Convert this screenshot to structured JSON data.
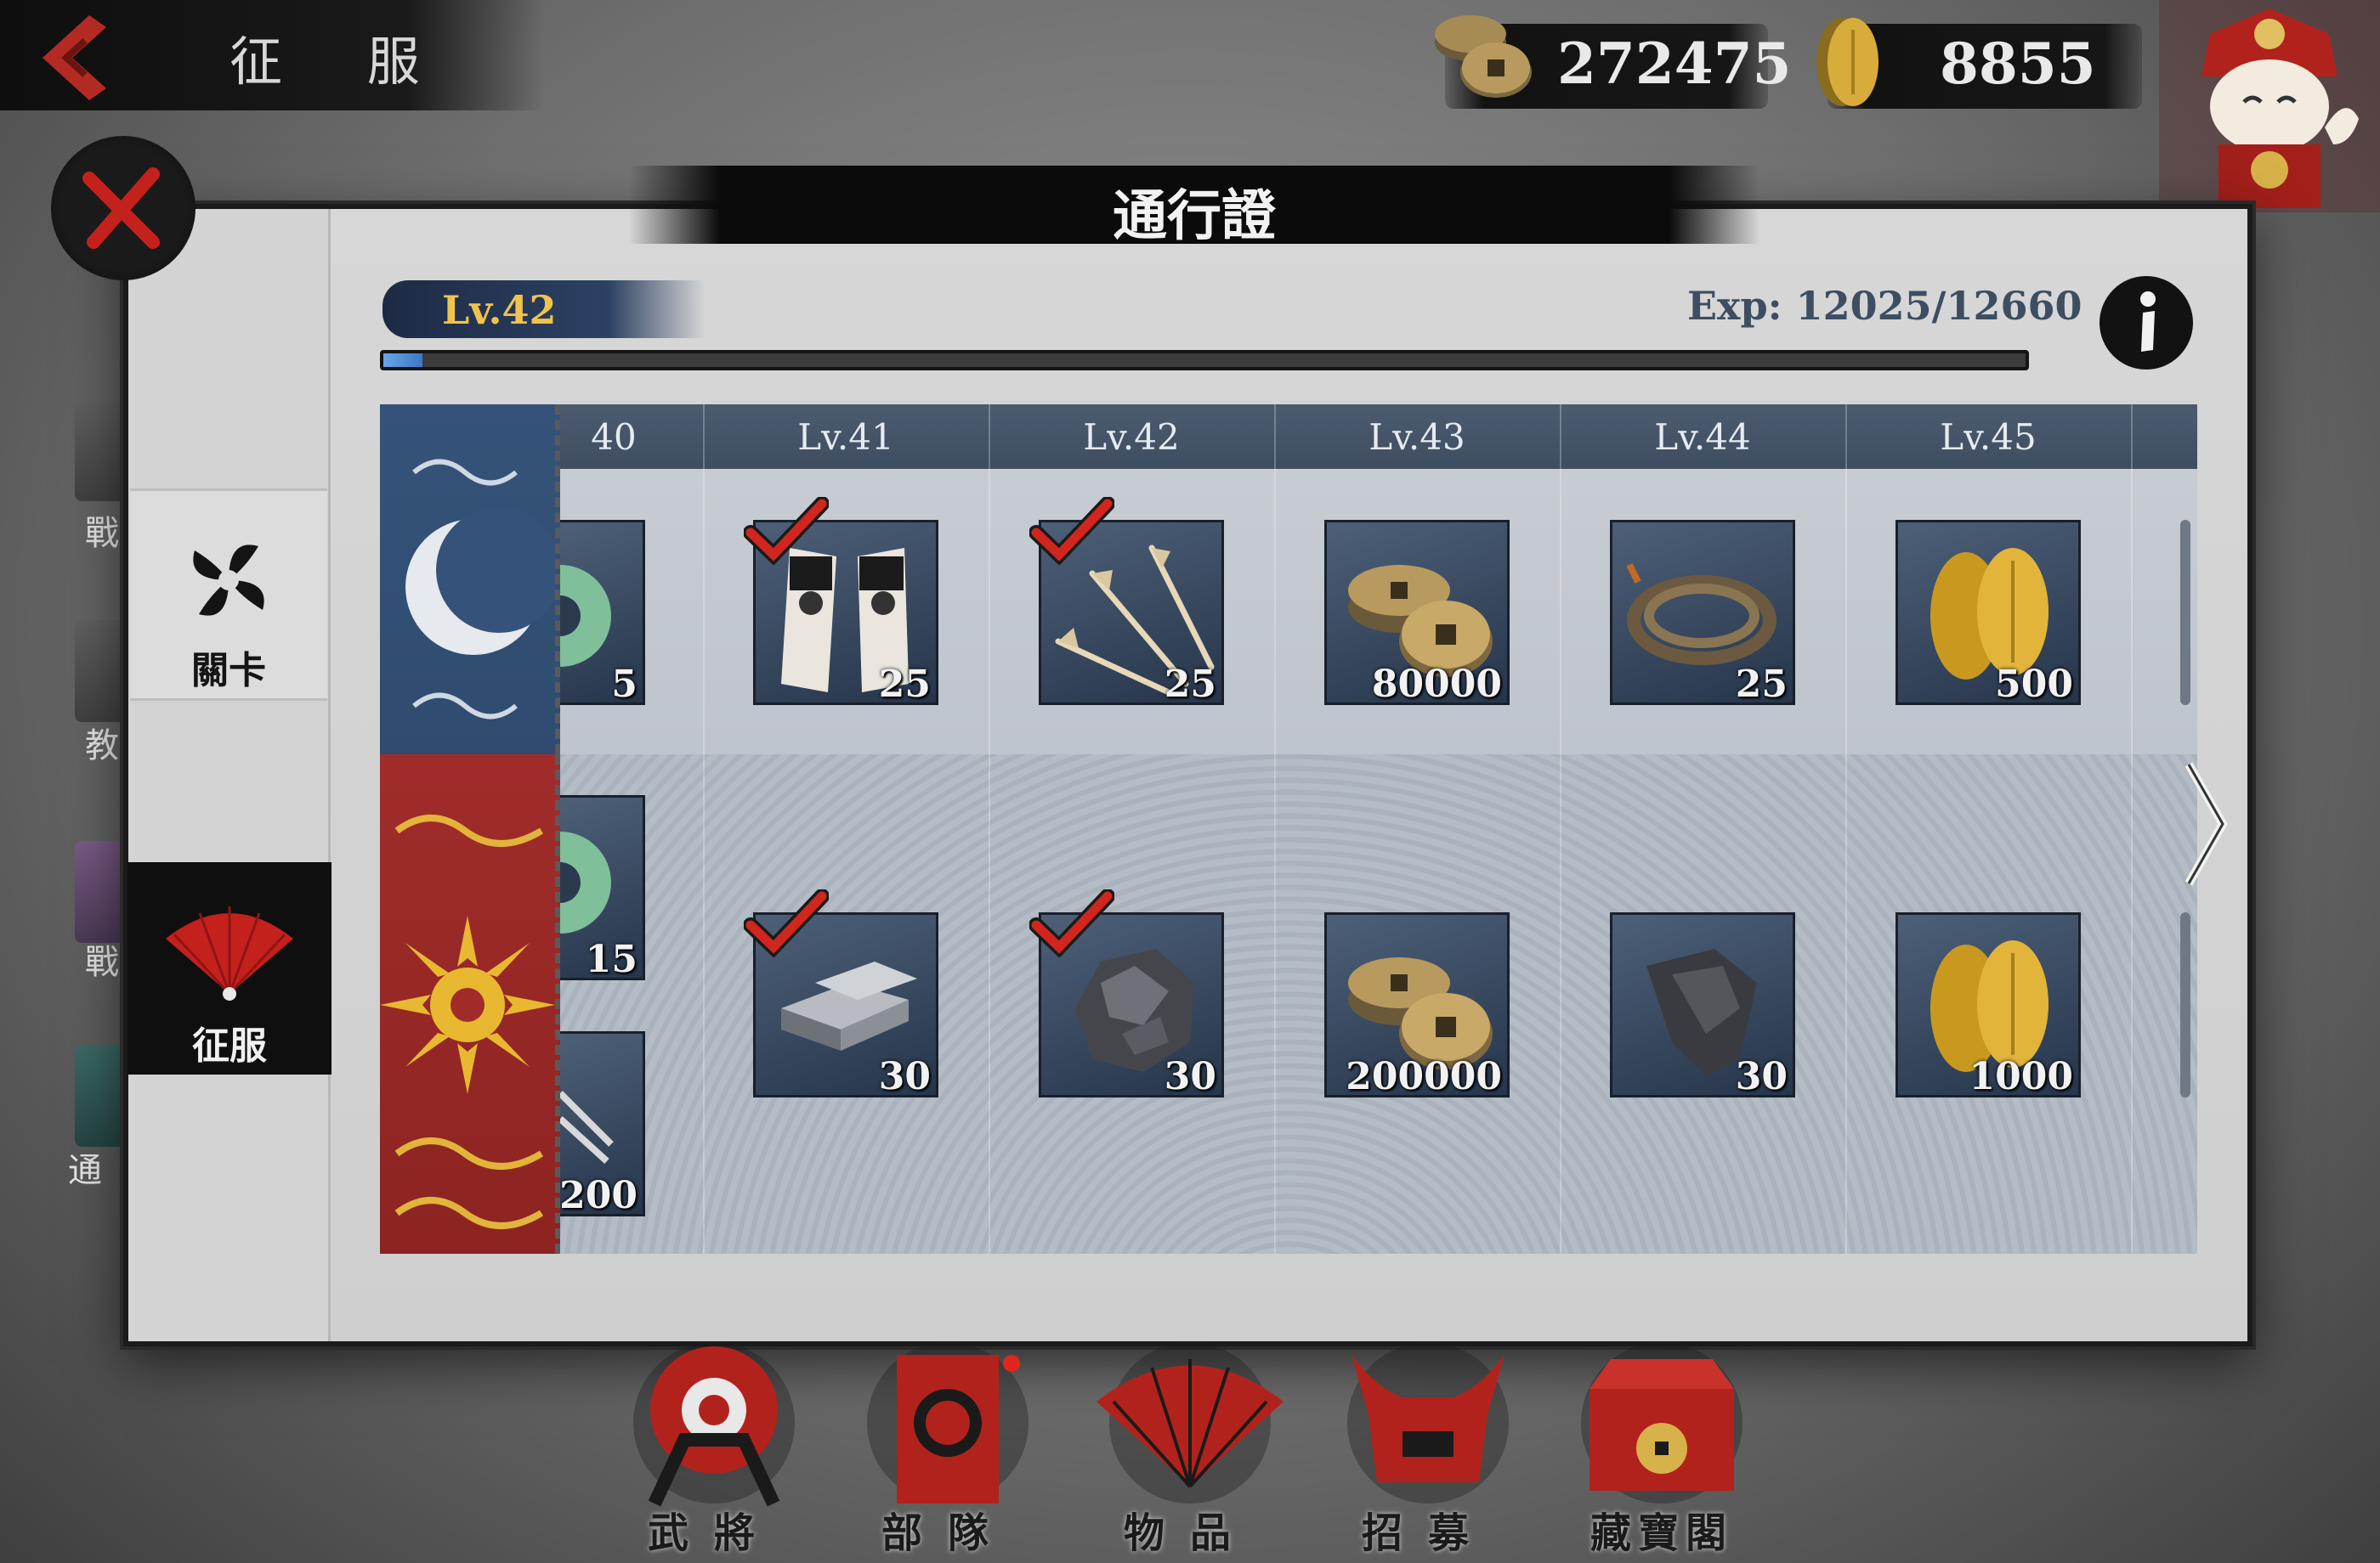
{
  "header": {
    "screen_title": "征 服",
    "coins": "272475",
    "gold": "8855"
  },
  "panel": {
    "title": "通行證",
    "level_badge": "Lv.42",
    "exp_text": "Exp: 12025/12660",
    "exp_current": 12025,
    "exp_max": 12660
  },
  "side_tabs": [
    {
      "label": "關卡",
      "icon": "pinwheel-icon",
      "active": false
    },
    {
      "label": "征服",
      "icon": "fan-icon",
      "active": true
    }
  ],
  "side_nav_ghost": [
    "戰",
    "教",
    "戰",
    "通"
  ],
  "partial_column": {
    "header": "40",
    "free_qty": "5",
    "paid_qty_1": "15",
    "paid_qty_2": "200"
  },
  "columns": [
    {
      "header": "Lv.41",
      "free": {
        "icon": "banner-flags-icon",
        "qty": "25",
        "claimed": true
      },
      "paid": {
        "icon": "iron-ingot-icon",
        "qty": "30",
        "claimed": true
      }
    },
    {
      "header": "Lv.42",
      "free": {
        "icon": "arrows-icon",
        "qty": "25",
        "claimed": true
      },
      "paid": {
        "icon": "ore-stone-icon",
        "qty": "30",
        "claimed": true
      }
    },
    {
      "header": "Lv.43",
      "free": {
        "icon": "coins-icon",
        "qty": "80000",
        "claimed": false
      },
      "paid": {
        "icon": "coins-icon",
        "qty": "200000",
        "claimed": false
      }
    },
    {
      "header": "Lv.44",
      "free": {
        "icon": "rope-icon",
        "qty": "25",
        "claimed": false
      },
      "paid": {
        "icon": "cloth-icon",
        "qty": "30",
        "claimed": false
      }
    },
    {
      "header": "Lv.45",
      "free": {
        "icon": "gold-koban-icon",
        "qty": "500",
        "claimed": false
      },
      "paid": {
        "icon": "gold-koban-icon",
        "qty": "1000",
        "claimed": false
      }
    }
  ],
  "bottom_nav": [
    {
      "label": "武將",
      "icon": "general-icon"
    },
    {
      "label": "部隊",
      "icon": "troops-banner-icon"
    },
    {
      "label": "物品",
      "icon": "items-fan-icon"
    },
    {
      "label": "招募",
      "icon": "recruit-helmet-icon"
    },
    {
      "label": "藏寶閣",
      "icon": "treasure-chest-icon"
    }
  ],
  "colors": {
    "accent_red": "#c4201c",
    "level_gold": "#f1c24c",
    "progress_blue": "#4f8fd6",
    "free_banner": "#35537a",
    "paid_banner": "#a02c2a"
  }
}
